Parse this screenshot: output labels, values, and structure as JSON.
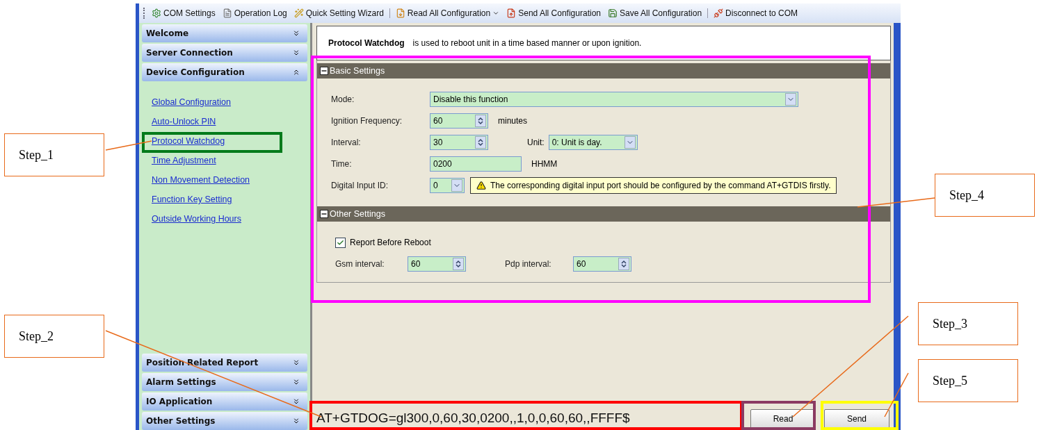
{
  "toolbar": [
    {
      "label": "COM Settings",
      "kind": "gear",
      "has_menu": false,
      "separator_after": false
    },
    {
      "label": "Operation Log",
      "kind": "log",
      "has_menu": false,
      "separator_after": false
    },
    {
      "label": "Quick Setting Wizard",
      "kind": "wizard",
      "has_menu": false,
      "separator_after": true
    },
    {
      "label": "Read All Configuration",
      "kind": "read",
      "has_menu": true,
      "separator_after": false
    },
    {
      "label": "Send All Configuration",
      "kind": "send",
      "has_menu": false,
      "separator_after": false
    },
    {
      "label": "Save All Configuration",
      "kind": "save",
      "has_menu": false,
      "separator_after": true
    },
    {
      "label": "Disconnect to COM",
      "kind": "disconnect",
      "has_menu": false,
      "separator_after": false
    }
  ],
  "sidebar": {
    "top_sections": [
      {
        "title": "Welcome",
        "expanded": false
      },
      {
        "title": "Server Connection",
        "expanded": false
      },
      {
        "title": "Device Configuration",
        "expanded": true,
        "items": [
          {
            "label": "Global Configuration"
          },
          {
            "label": "Auto-Unlock PIN"
          },
          {
            "label": "Protocol Watchdog"
          },
          {
            "label": "Time Adjustment"
          },
          {
            "label": "Non Movement Detection"
          },
          {
            "label": "Function Key Setting"
          },
          {
            "label": "Outside Working Hours"
          }
        ]
      }
    ],
    "bottom_sections": [
      {
        "title": "Position Related Report",
        "expanded": false
      },
      {
        "title": "Alarm Settings",
        "expanded": false
      },
      {
        "title": "IO Application",
        "expanded": false
      },
      {
        "title": "Other Settings",
        "expanded": false
      }
    ]
  },
  "description": {
    "title": "Protocol Watchdog",
    "text": "is used to reboot unit in a time based manner or upon ignition."
  },
  "basic": {
    "title": "Basic Settings",
    "expanded": true,
    "mode": {
      "label": "Mode:",
      "value": "Disable this function"
    },
    "ignition": {
      "label": "Ignition Frequency:",
      "value": "60",
      "unit": "minutes"
    },
    "interval": {
      "label": "Interval:",
      "value": "30",
      "unit_label": "Unit:",
      "unit_value": "0: Unit is day."
    },
    "time": {
      "label": "Time:",
      "value": "0200",
      "unit": "HHMM"
    },
    "digital_input": {
      "label": "Digital Input ID:",
      "value": "0",
      "hint": "The corresponding digital input port should be configured by the command AT+GTDIS firstly."
    }
  },
  "other": {
    "title": "Other Settings",
    "expanded": true,
    "report": {
      "label": "Report Before Reboot",
      "checked": true
    },
    "gsm": {
      "label": "Gsm interval:",
      "value": "60"
    },
    "pdp": {
      "label": "Pdp interval:",
      "value": "60"
    }
  },
  "command": {
    "value": "AT+GTDOG=gl300,0,60,30,0200,,1,0,0,60,60,,FFFF$"
  },
  "buttons": [
    "Read",
    "Send"
  ],
  "annotations": {
    "steps": [
      {
        "label": "Step_1"
      },
      {
        "label": "Step_2"
      },
      {
        "label": "Step_3"
      },
      {
        "label": "Step_4"
      },
      {
        "label": "Step_5"
      }
    ],
    "frames": [
      {
        "color": "#007a1a"
      },
      {
        "color": "#ff00ff"
      },
      {
        "color": "#ff0000"
      },
      {
        "color": "#8b3a62"
      },
      {
        "color": "#ffff00"
      }
    ]
  }
}
